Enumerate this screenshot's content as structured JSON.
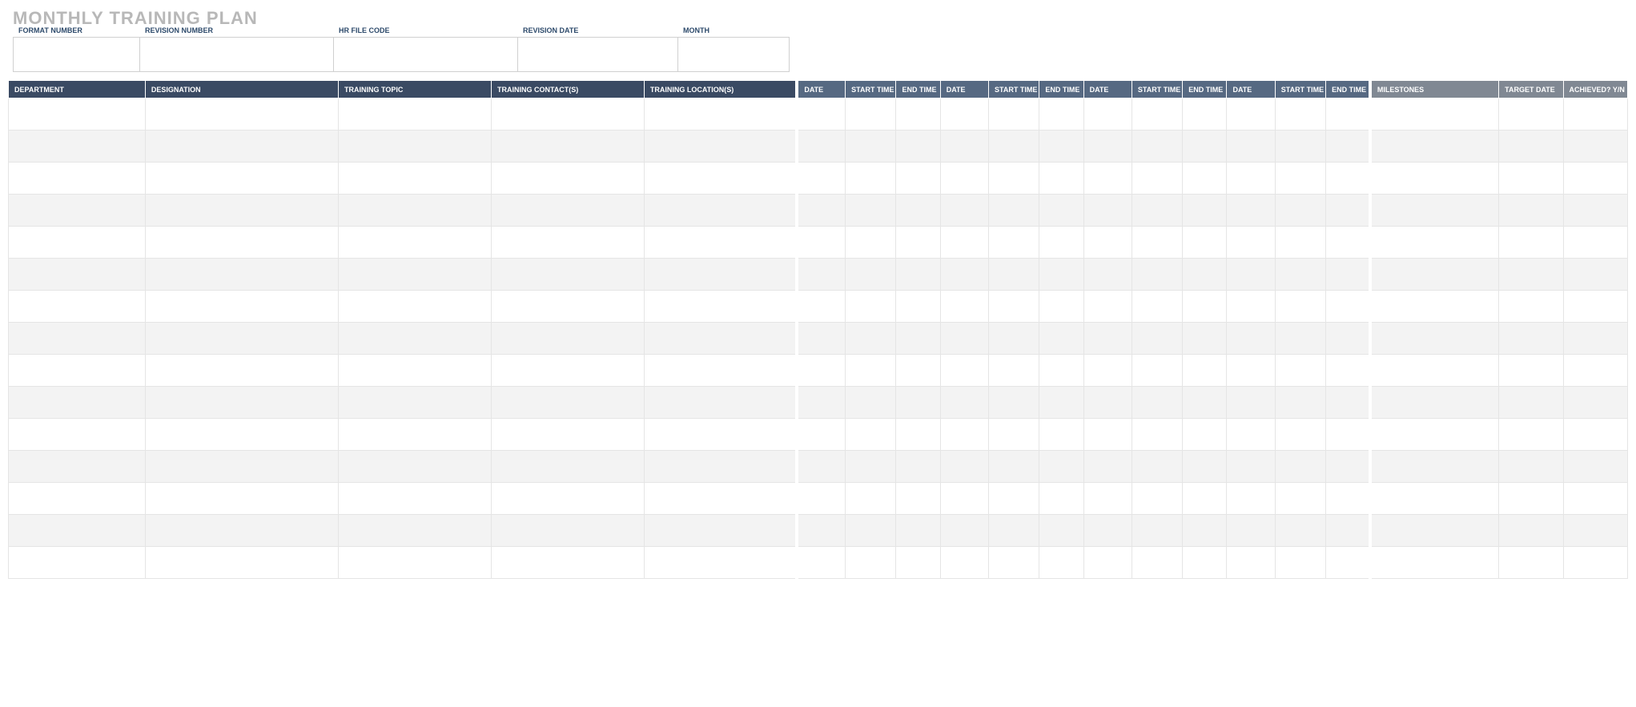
{
  "title": "MONTHLY TRAINING PLAN",
  "meta": {
    "format_number": {
      "label": "FORMAT NUMBER",
      "value": ""
    },
    "revision_number": {
      "label": "REVISION NUMBER",
      "value": ""
    },
    "hr_file_code": {
      "label": "HR FILE CODE",
      "value": ""
    },
    "revision_date": {
      "label": "REVISION DATE",
      "value": ""
    },
    "month": {
      "label": "MONTH",
      "value": ""
    }
  },
  "headers": {
    "department": "DEPARTMENT",
    "designation": "DESIGNATION",
    "training_topic": "TRAINING TOPIC",
    "training_contacts": "TRAINING CONTACT(S)",
    "training_locations": "TRAINING LOCATION(S)",
    "date": "DATE",
    "start_time": "START TIME",
    "end_time": "END TIME",
    "milestones": "MILESTONES",
    "target_date": "TARGET DATE",
    "achieved": "ACHIEVED? Y/N"
  },
  "row_count": 15
}
